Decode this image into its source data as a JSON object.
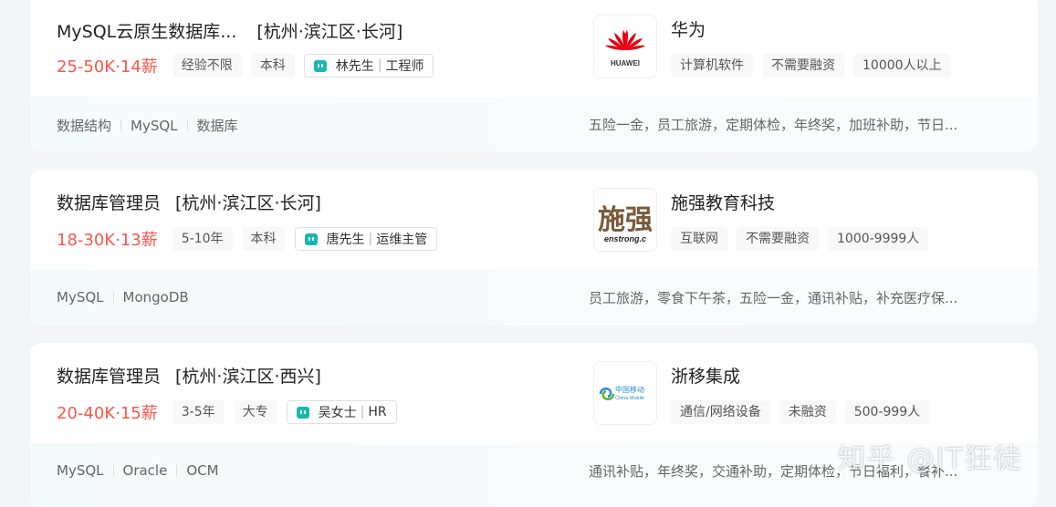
{
  "jobs": [
    {
      "title": "MySQL云原生数据库...",
      "area": "[杭州·滨江区·长河]",
      "salary": "25-50K·14薪",
      "tags": [
        "经验不限",
        "本科"
      ],
      "recruiter": {
        "name": "林先生",
        "role": "工程师"
      },
      "company": {
        "name": "华为",
        "logo_text": "HUAWEI",
        "tags": [
          "计算机软件",
          "不需要融资",
          "10000人以上"
        ]
      },
      "skills": [
        "数据结构",
        "MySQL",
        "数据库"
      ],
      "benefits": "五险一金，员工旅游，定期体检，年终奖，加班补助，节日..."
    },
    {
      "title": "数据库管理员",
      "area": "[杭州·滨江区·长河]",
      "salary": "18-30K·13薪",
      "tags": [
        "5-10年",
        "本科"
      ],
      "recruiter": {
        "name": "唐先生",
        "role": "运维主管"
      },
      "company": {
        "name": "施强教育科技",
        "logo_text": "施强",
        "logo_sub": "enstrong.c",
        "tags": [
          "互联网",
          "不需要融资",
          "1000-9999人"
        ]
      },
      "skills": [
        "MySQL",
        "MongoDB"
      ],
      "benefits": "员工旅游，零食下午茶，五险一金，通讯补贴，补充医疗保..."
    },
    {
      "title": "数据库管理员",
      "area": "[杭州·滨江区·西兴]",
      "salary": "20-40K·15薪",
      "tags": [
        "3-5年",
        "大专"
      ],
      "recruiter": {
        "name": "吴女士",
        "role": "HR"
      },
      "company": {
        "name": "浙移集成",
        "logo_text": "中国移动",
        "logo_sub": "China Mobile",
        "tags": [
          "通信/网络设备",
          "未融资",
          "500-999人"
        ]
      },
      "skills": [
        "MySQL",
        "Oracle",
        "OCM"
      ],
      "benefits": "通讯补贴，年终奖，交通补助，定期体检，节日福利，餐补..."
    }
  ],
  "watermark": "知乎 @IT狂徒",
  "colors": {
    "salary": "#fe574a",
    "chat_icon": "#19b7b1",
    "huawei_red": "#e60012"
  }
}
